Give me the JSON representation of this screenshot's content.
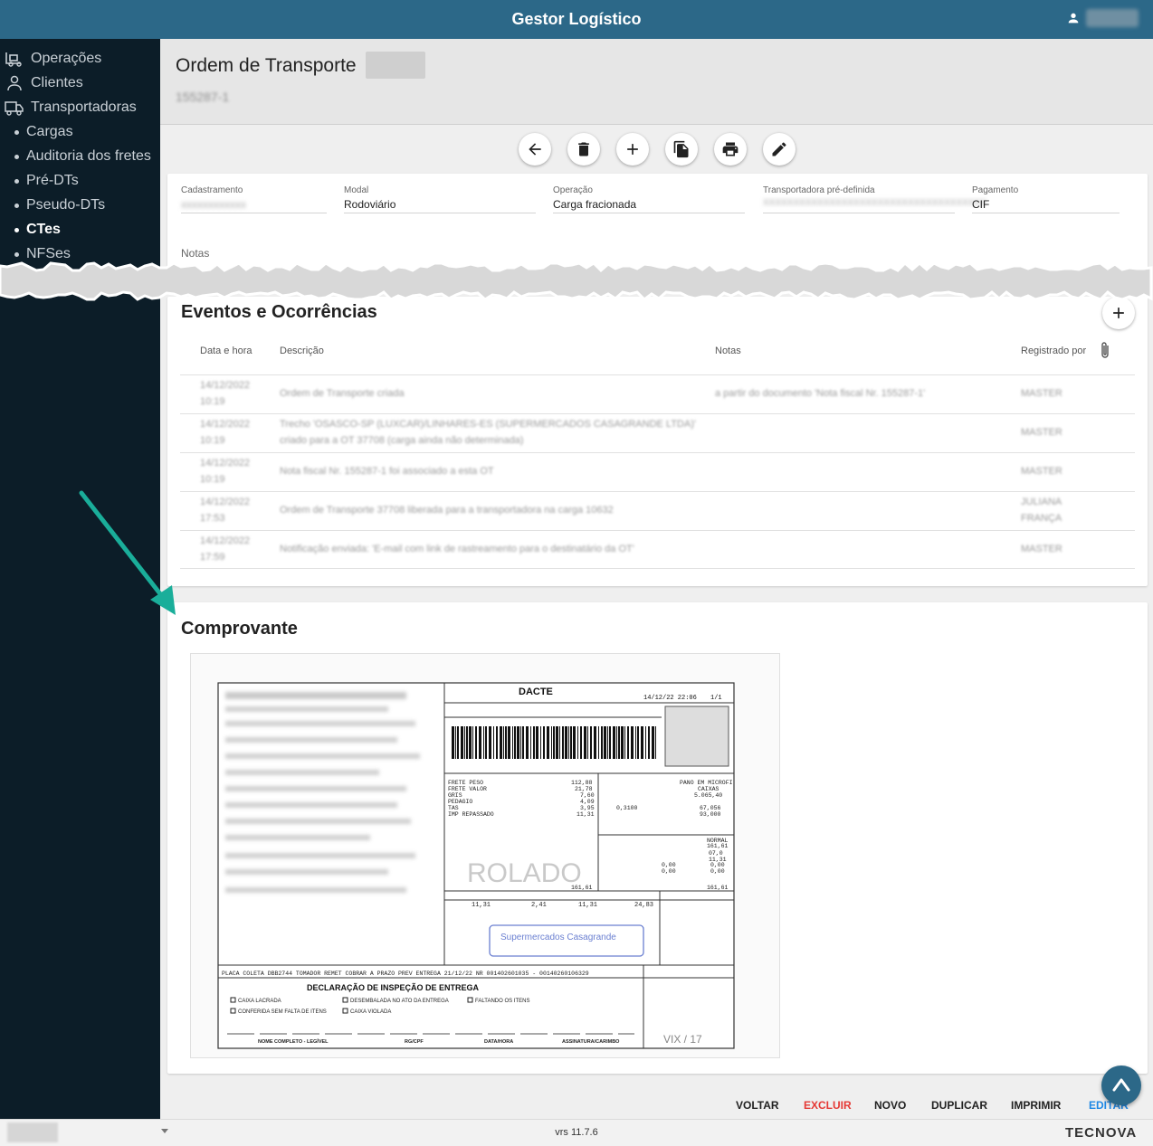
{
  "app": {
    "title": "Gestor Logístico",
    "version": "vrs 11.7.6",
    "brand": "TECNOVA"
  },
  "sidebar": {
    "items": [
      {
        "label": "Operações",
        "icon": "forklift-icon"
      },
      {
        "label": "Clientes",
        "icon": "person-icon"
      },
      {
        "label": "Transportadoras",
        "icon": "truck-icon"
      }
    ],
    "subitems": [
      {
        "label": "Cargas"
      },
      {
        "label": "Auditoria dos fretes"
      },
      {
        "label": "Pré-DTs"
      },
      {
        "label": "Pseudo-DTs"
      },
      {
        "label": "CTes",
        "active": true
      },
      {
        "label": "NFSes"
      }
    ]
  },
  "page": {
    "title": "Ordem de Transporte",
    "subtitle": "155287-1"
  },
  "toolbar": [
    "arrow-back-icon",
    "trash-icon",
    "plus-icon",
    "duplicate-icon",
    "print-icon",
    "edit-pencil-icon"
  ],
  "form": {
    "fields": [
      {
        "label": "Cadastramento",
        "value": "",
        "blurred": true
      },
      {
        "label": "Modal",
        "value": "Rodoviário"
      },
      {
        "label": "Operação",
        "value": "Carga fracionada"
      },
      {
        "label": "Transportadora pré-definida",
        "value": "",
        "blurred": true
      },
      {
        "label": "Pagamento",
        "value": "CIF"
      }
    ],
    "notes_label": "Notas"
  },
  "events": {
    "title": "Eventos e Ocorrências",
    "columns": [
      "Data e hora",
      "Descrição",
      "Notas",
      "Registrado por"
    ],
    "rows": [
      {
        "date": "14/12/2022",
        "time": "10:19",
        "desc": "Ordem de Transporte criada",
        "notes": "a partir do documento 'Nota fiscal Nr. 155287-1'",
        "by": "MASTER"
      },
      {
        "date": "14/12/2022",
        "time": "10:19",
        "desc": "Trecho 'OSASCO-SP (LUXCAR)/LINHARES-ES (SUPERMERCADOS CASAGRANDE LTDA)' criado para a OT 37708 (carga ainda não determinada)",
        "notes": "",
        "by": "MASTER"
      },
      {
        "date": "14/12/2022",
        "time": "10:19",
        "desc": "Nota fiscal Nr. 155287-1 foi associado a esta OT",
        "notes": "",
        "by": "MASTER"
      },
      {
        "date": "14/12/2022",
        "time": "17:53",
        "desc": "Ordem de Transporte 37708 liberada para a transportadora na carga 10632",
        "notes": "",
        "by": "JULIANA FRANÇA"
      },
      {
        "date": "14/12/2022",
        "time": "17:59",
        "desc": "Notificação enviada: 'E-mail com link de rastreamento para o destinatário da OT'",
        "notes": "",
        "by": "MASTER"
      }
    ]
  },
  "comprovante": {
    "title": "Comprovante",
    "doc": {
      "header": "DACTE",
      "autorizacao": "14/12/22 22:06",
      "fl": "1/1",
      "inspection_title": "DECLARAÇÃO DE INSPEÇÃO DE ENTREGA",
      "checks": [
        "CAIXA LACRADA",
        "DESEMBALADA NO ATO DA ENTREGA",
        "FALTANDO OS ITENS",
        "CONFERIDA SEM FALTA DE ITENS",
        "CAIXA VIOLADA"
      ],
      "footer_labels": [
        "NOME COMPLETO - LEGÍVEL",
        "RG/CPF",
        "DATA/HORA",
        "ASSINATURA/CARIMBO"
      ],
      "stamp_text": "Supermercados Casagrande",
      "watermark": "ROLADO",
      "code": "VIX / 17"
    }
  },
  "actions": {
    "back": "VOLTAR",
    "delete": "EXCLUIR",
    "new": "NOVO",
    "duplicate": "DUPLICAR",
    "print": "IMPRIMIR",
    "edit": "EDITAR"
  },
  "colors": {
    "topbar": "#2c6888",
    "sidebar": "#0c1d28",
    "danger": "#e53935",
    "link": "#1e88e5",
    "arrow": "#1aae9a"
  }
}
